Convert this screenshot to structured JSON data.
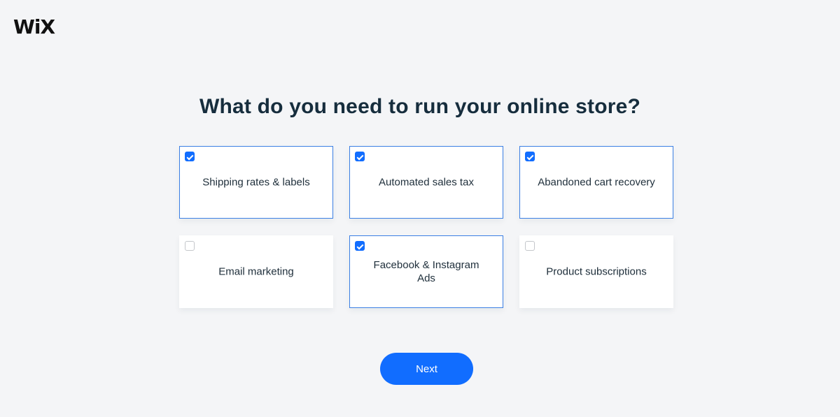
{
  "brand": {
    "logo_text": "WiX"
  },
  "page": {
    "title": "What do you need to run your online store?"
  },
  "options": [
    {
      "label": "Shipping rates & labels",
      "checked": true
    },
    {
      "label": "Automated sales tax",
      "checked": true
    },
    {
      "label": "Abandoned cart recovery",
      "checked": true
    },
    {
      "label": "Email marketing",
      "checked": false
    },
    {
      "label": "Facebook & Instagram Ads",
      "checked": true
    },
    {
      "label": "Product subscriptions",
      "checked": false
    }
  ],
  "actions": {
    "next_label": "Next"
  },
  "colors": {
    "accent": "#116dff",
    "selected_border": "#3b7fe4",
    "background": "#f4f5f7"
  }
}
